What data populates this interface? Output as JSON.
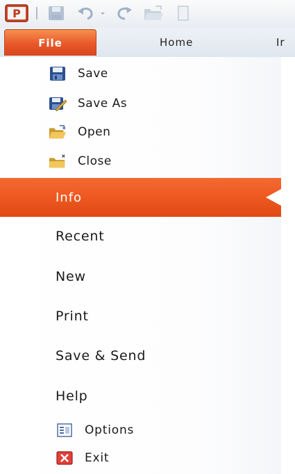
{
  "quick_access": {
    "icons": [
      "powerpoint-logo-icon",
      "save-icon",
      "undo-icon",
      "undo-dropdown-icon",
      "redo-icon",
      "open-icon",
      "new-document-icon"
    ],
    "app_letter": "P"
  },
  "tabs": {
    "file_label": "File",
    "home_label": "Home",
    "insert_label": "Ir"
  },
  "backstage": {
    "commands": [
      {
        "label": "Save",
        "icon": "save-icon"
      },
      {
        "label": "Save As",
        "icon": "save-as-icon"
      },
      {
        "label": "Open",
        "icon": "open-folder-icon"
      },
      {
        "label": "Close",
        "icon": "close-folder-icon"
      }
    ],
    "info_label": "Info",
    "nav": [
      "Recent",
      "New",
      "Print",
      "Save & Send",
      "Help"
    ],
    "sub": [
      {
        "label": "Options",
        "icon": "options-icon"
      },
      {
        "label": "Exit",
        "icon": "exit-icon"
      }
    ]
  },
  "colors": {
    "accent_orange": "#ee5a22",
    "file_tab": "#e8572a",
    "panel_border": "#c9ced6"
  }
}
